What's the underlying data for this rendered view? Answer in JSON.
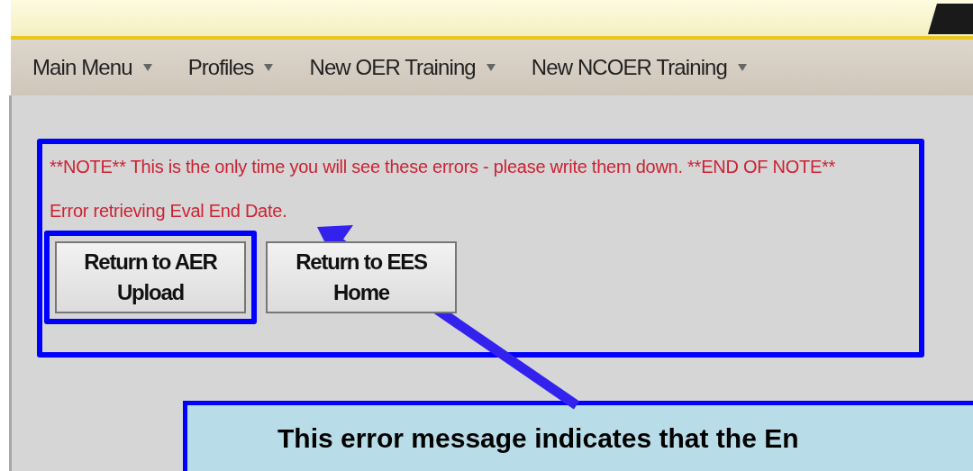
{
  "nav": {
    "items": [
      {
        "label": "Main Menu"
      },
      {
        "label": "Profiles"
      },
      {
        "label": "New OER Training"
      },
      {
        "label": "New NCOER Training"
      }
    ]
  },
  "message": {
    "note": "**NOTE** This is the only time you will see these errors - please write them down. **END OF NOTE**",
    "error": "Error retrieving Eval End Date."
  },
  "buttons": [
    {
      "label": "Return to AER Upload",
      "highlighted": true
    },
    {
      "label": "Return to EES Home",
      "highlighted": false
    }
  ],
  "callout": {
    "text": "This error message indicates that the En"
  }
}
